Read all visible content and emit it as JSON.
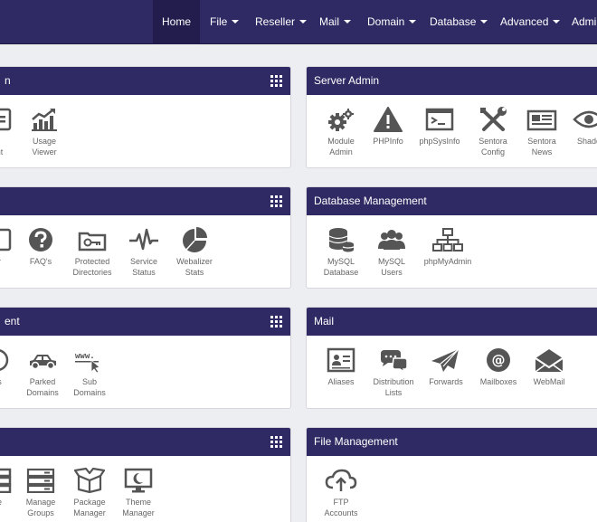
{
  "nav": {
    "home": "Home",
    "file": "File",
    "reseller": "Reseller",
    "mail": "Mail",
    "domain": "Domain",
    "database": "Database",
    "advanced": "Advanced",
    "admin": "Admin"
  },
  "panels": {
    "account": {
      "title_fragment": "n",
      "items": {
        "item1_line1": "t",
        "item1_line2": "unt",
        "usage_line1": "Usage",
        "usage_line2": "Viewer"
      }
    },
    "server_admin": {
      "title": "Server Admin",
      "items": {
        "module_line1": "Module",
        "module_line2": "Admin",
        "phpinfo": "PHPInfo",
        "phpsysinfo": "phpSysInfo",
        "sentora_config_line1": "Sentora",
        "sentora_config_line2": "Config",
        "sentora_news_line1": "Sentora",
        "sentora_news_line2": "News",
        "shadow_fragment": "Shado"
      }
    },
    "advanced": {
      "items": {
        "cut_label": "er",
        "faqs": "FAQ's",
        "protected_line1": "Protected",
        "protected_line2": "Directories",
        "service_line1": "Service",
        "service_line2": "Status",
        "webalizer_line1": "Webalizer",
        "webalizer_line2": "Stats"
      }
    },
    "database_management": {
      "title": "Database Management",
      "items": {
        "mysql_db_line1": "MySQL",
        "mysql_db_line2": "Database",
        "mysql_users_line1": "MySQL",
        "mysql_users_line2": "Users",
        "phpmyadmin": "phpMyAdmin"
      }
    },
    "domain_management": {
      "title_fragment": "ent",
      "items": {
        "cut_label": "ns",
        "parked_line1": "Parked",
        "parked_line2": "Domains",
        "sub_line1": "Sub",
        "sub_line2": "Domains"
      }
    },
    "mail": {
      "title": "Mail",
      "items": {
        "aliases": "Aliases",
        "distribution_line1": "Distribution",
        "distribution_line2": "Lists",
        "forwards": "Forwards",
        "mailboxes": "Mailboxes",
        "webmail": "WebMail"
      }
    },
    "reseller": {
      "items": {
        "cut_line1": "ge",
        "cut_line2": "s",
        "groups_line1": "Manage",
        "groups_line2": "Groups",
        "package_line1": "Package",
        "package_line2": "Manager",
        "theme_line1": "Theme",
        "theme_line2": "Manager"
      }
    },
    "file_management": {
      "title": "File Management",
      "items": {
        "ftp_line1": "FTP",
        "ftp_line2": "Accounts"
      }
    }
  },
  "colors": {
    "navbar": "#2f2a63",
    "navbar_active": "#221d4d",
    "icon": "#555555",
    "label": "#666666"
  }
}
